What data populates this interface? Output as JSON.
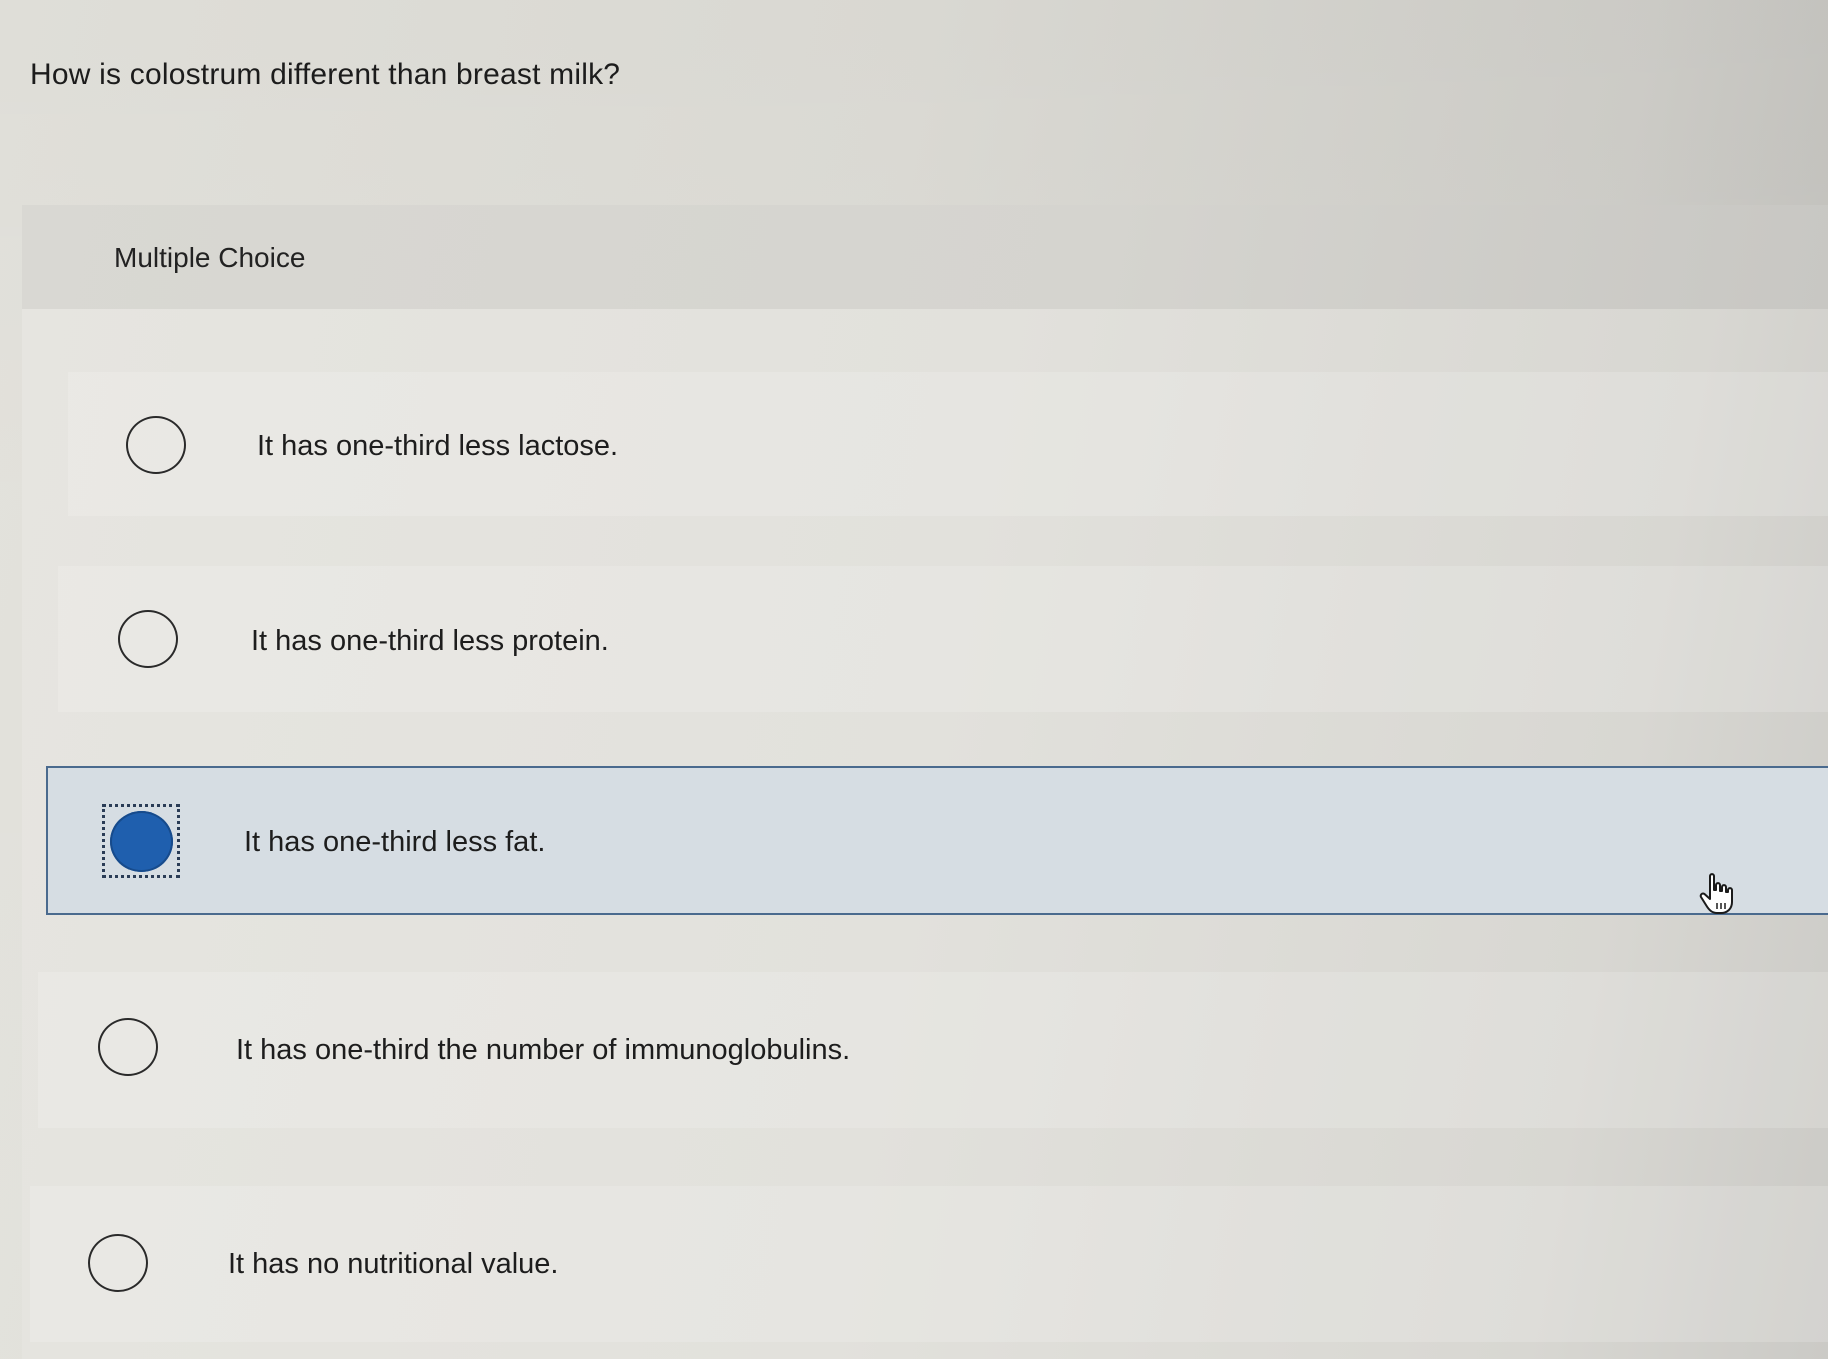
{
  "question": {
    "text": "How is colostrum different than breast milk?"
  },
  "question_type": "Multiple Choice",
  "options": [
    {
      "label": "It has one-third less lactose.",
      "selected": false
    },
    {
      "label": "It has one-third less protein.",
      "selected": false
    },
    {
      "label": "It has one-third less fat.",
      "selected": true
    },
    {
      "label": "It has one-third the number of immunoglobulins.",
      "selected": false
    },
    {
      "label": "It has no nutritional value.",
      "selected": false
    }
  ],
  "colors": {
    "selected_fill": "#1f5fae",
    "selected_border": "#4a6a8e",
    "selected_background": "#d6dde3"
  },
  "icons": {
    "cursor": "hand-pointer-icon"
  }
}
